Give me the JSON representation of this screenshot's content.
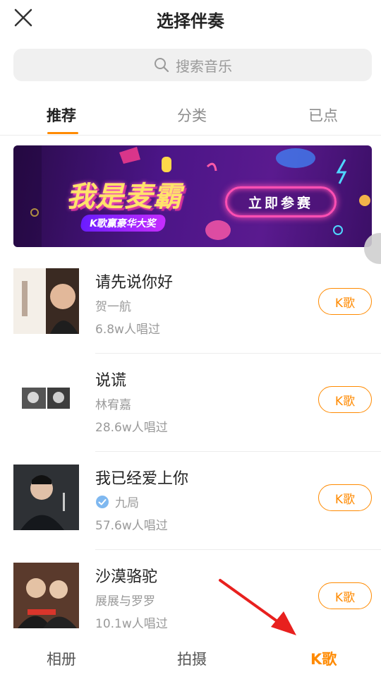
{
  "header": {
    "title": "选择伴奏",
    "close_icon": "close-icon"
  },
  "search": {
    "placeholder": "搜索音乐",
    "icon": "search-icon"
  },
  "tabs": [
    {
      "label": "推荐",
      "active": true
    },
    {
      "label": "分类",
      "active": false
    },
    {
      "label": "已点",
      "active": false
    }
  ],
  "banner": {
    "headline": "我是麦霸",
    "subline": "K歌赢豪华大奖",
    "cta": "立即参赛"
  },
  "songs": [
    {
      "title": "请先说你好",
      "artist": "贺一航",
      "plays": "6.8w人唱过",
      "button": "K歌",
      "verified": false
    },
    {
      "title": "说谎",
      "artist": "林宥嘉",
      "plays": "28.6w人唱过",
      "button": "K歌",
      "verified": false
    },
    {
      "title": "我已经爱上你",
      "artist": "九局",
      "plays": "57.6w人唱过",
      "button": "K歌",
      "verified": true
    },
    {
      "title": "沙漠骆驼",
      "artist": "展展与罗罗",
      "plays": "10.1w人唱过",
      "button": "K歌",
      "verified": false
    }
  ],
  "bottom_nav": [
    {
      "label": "相册",
      "active": false
    },
    {
      "label": "拍摄",
      "active": false
    },
    {
      "label": "K歌",
      "active": true
    }
  ],
  "colors": {
    "accent": "#ff8a00",
    "annotation_arrow": "#e8201e"
  }
}
